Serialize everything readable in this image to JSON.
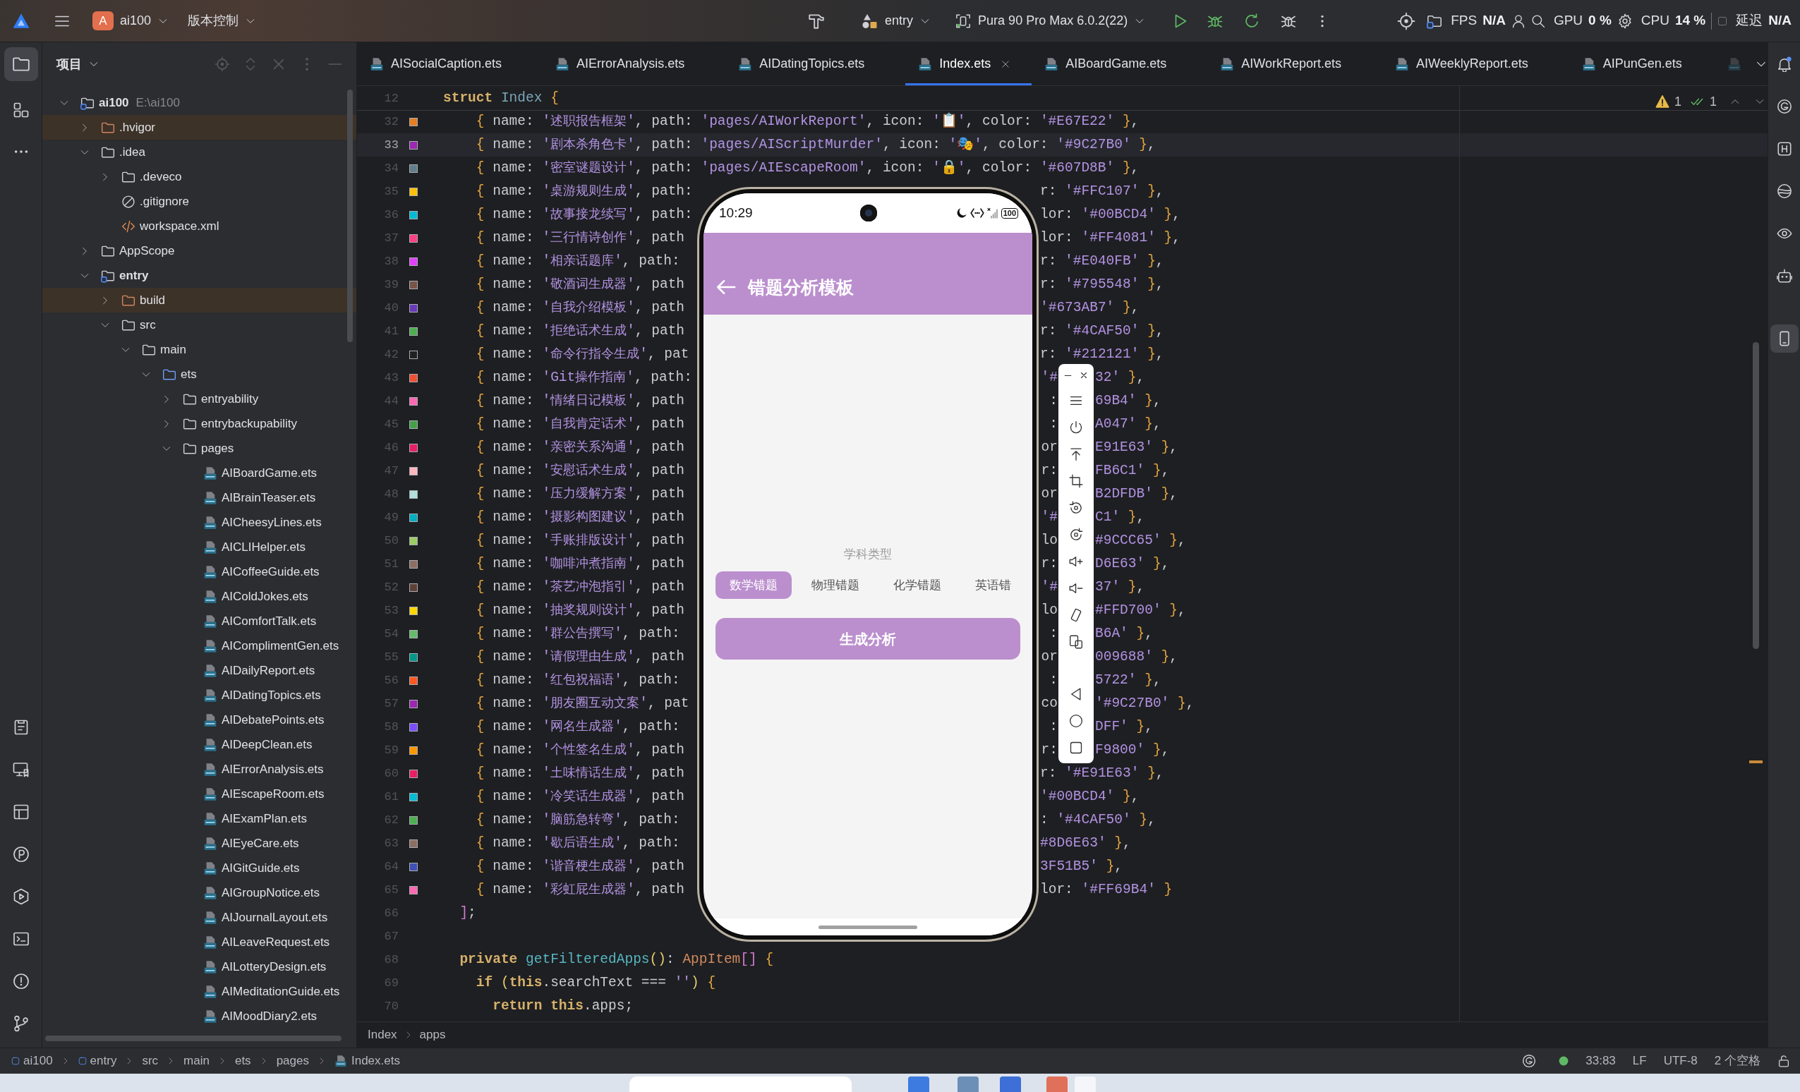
{
  "title_bar": {
    "project_badge": "A",
    "project": "ai100",
    "vcs_menu": "版本控制",
    "run_config": "entry",
    "device": "Pura 90 Pro Max 6.0.2(22)",
    "perf": [
      {
        "label": "FPS",
        "value": "N/A"
      },
      {
        "label": "GPU",
        "value": "0 %"
      },
      {
        "label": "CPU",
        "value": "14 %"
      },
      {
        "label": "延迟",
        "value": "N/A"
      }
    ]
  },
  "project_panel": {
    "title": "项目",
    "tree": [
      {
        "label": "ai100",
        "kind": "module",
        "location": "E:\\ai100",
        "expanded": true,
        "children": [
          {
            "label": ".hvigor",
            "kind": "excluded",
            "expanded": false
          },
          {
            "label": ".idea",
            "kind": "folder",
            "expanded": true,
            "children": [
              {
                "label": ".deveco",
                "kind": "folder",
                "expanded": false
              },
              {
                "label": ".gitignore",
                "kind": "ignore"
              },
              {
                "label": "workspace.xml",
                "kind": "xml"
              }
            ]
          },
          {
            "label": "AppScope",
            "kind": "folder",
            "expanded": false
          },
          {
            "label": "entry",
            "kind": "module",
            "expanded": true,
            "children": [
              {
                "label": "build",
                "kind": "excluded",
                "expanded": false
              },
              {
                "label": "src",
                "kind": "folder",
                "expanded": true,
                "children": [
                  {
                    "label": "main",
                    "kind": "folder",
                    "expanded": true,
                    "children": [
                      {
                        "label": "ets",
                        "kind": "source",
                        "expanded": true,
                        "children": [
                          {
                            "label": "entryability",
                            "kind": "folder",
                            "expanded": false
                          },
                          {
                            "label": "entrybackupability",
                            "kind": "folder",
                            "expanded": false
                          },
                          {
                            "label": "pages",
                            "kind": "folder",
                            "expanded": true,
                            "children": [
                              {
                                "label": "AIBoardGame.ets",
                                "kind": "ets"
                              },
                              {
                                "label": "AIBrainTeaser.ets",
                                "kind": "ets"
                              },
                              {
                                "label": "AICheesyLines.ets",
                                "kind": "ets"
                              },
                              {
                                "label": "AICLIHelper.ets",
                                "kind": "ets"
                              },
                              {
                                "label": "AICoffeeGuide.ets",
                                "kind": "ets"
                              },
                              {
                                "label": "AIColdJokes.ets",
                                "kind": "ets"
                              },
                              {
                                "label": "AIComfortTalk.ets",
                                "kind": "ets"
                              },
                              {
                                "label": "AIComplimentGen.ets",
                                "kind": "ets"
                              },
                              {
                                "label": "AIDailyReport.ets",
                                "kind": "ets"
                              },
                              {
                                "label": "AIDatingTopics.ets",
                                "kind": "ets"
                              },
                              {
                                "label": "AIDebatePoints.ets",
                                "kind": "ets"
                              },
                              {
                                "label": "AIDeepClean.ets",
                                "kind": "ets"
                              },
                              {
                                "label": "AIErrorAnalysis.ets",
                                "kind": "ets"
                              },
                              {
                                "label": "AIEscapeRoom.ets",
                                "kind": "ets"
                              },
                              {
                                "label": "AIExamPlan.ets",
                                "kind": "ets"
                              },
                              {
                                "label": "AIEyeCare.ets",
                                "kind": "ets"
                              },
                              {
                                "label": "AIGitGuide.ets",
                                "kind": "ets"
                              },
                              {
                                "label": "AIGroupNotice.ets",
                                "kind": "ets"
                              },
                              {
                                "label": "AIJournalLayout.ets",
                                "kind": "ets"
                              },
                              {
                                "label": "AILeaveRequest.ets",
                                "kind": "ets"
                              },
                              {
                                "label": "AILotteryDesign.ets",
                                "kind": "ets"
                              },
                              {
                                "label": "AIMeditationGuide.ets",
                                "kind": "ets"
                              },
                              {
                                "label": "AIMoodDiary2.ets",
                                "kind": "ets"
                              }
                            ]
                          }
                        ]
                      }
                    ]
                  }
                ]
              }
            ]
          }
        ]
      }
    ]
  },
  "editor_tabs": [
    {
      "label": "AISocialCaption.ets",
      "selected": false
    },
    {
      "label": "AIErrorAnalysis.ets",
      "selected": false
    },
    {
      "label": "AIDatingTopics.ets",
      "selected": false
    },
    {
      "label": "Index.ets",
      "selected": true
    },
    {
      "label": "AIBoardGame.ets",
      "selected": false
    },
    {
      "label": "AIWorkReport.ets",
      "selected": false
    },
    {
      "label": "AIWeeklyReport.ets",
      "selected": false
    },
    {
      "label": "AIPunGen.ets",
      "selected": false
    }
  ],
  "editor": {
    "warning_count": "1",
    "check_count": "1",
    "lines": [
      {
        "number": "12",
        "kind": "sticky",
        "current": false,
        "tokens": [
          {
            "kind": "keyword",
            "text": "struct"
          },
          {
            "kind": "class",
            "text": " Index"
          },
          {
            "kind": "plain",
            "text": " {"
          }
        ]
      },
      {
        "number": "32",
        "kind": "code",
        "color": "#E67E22",
        "current": false,
        "tokens": [
          {
            "kind": "plain",
            "text": "    { name: '述职报告框架', path: 'pages/AIWorkReport', icon: '📋', color: '#E67E22' },"
          }
        ]
      },
      {
        "number": "33",
        "kind": "code",
        "color": "#9C27B0",
        "current": true,
        "tokens": [
          {
            "kind": "plain",
            "text": "    { name: '剧本杀角色卡', path: 'pages/AIScriptMurder', icon: '🎭', color: '#9C27B0' },"
          }
        ]
      },
      {
        "number": "34",
        "kind": "code",
        "color": "#607D8B",
        "current": false,
        "tokens": [
          {
            "kind": "plain",
            "text": "    { name: '密室谜题设计', path: 'pages/AIEscapeRoom', icon: '🔒', color: '#607D8B' },"
          }
        ]
      },
      {
        "number": "35",
        "kind": "code",
        "color": "#FFC107",
        "current": false,
        "tokens": [
          {
            "kind": "plain",
            "text": "    { name: '桌游规则生成', path:"
          }
        ],
        "after_phone": [
          {
            "kind": "plain",
            "text": "r: '#FFC107' },"
          }
        ]
      },
      {
        "number": "36",
        "kind": "code",
        "color": "#00BCD4",
        "current": false,
        "tokens": [
          {
            "kind": "plain",
            "text": "    { name: '故事接龙续写', path:"
          }
        ],
        "after_phone": [
          {
            "kind": "plain",
            "text": "lor: '#00BCD4' },"
          }
        ]
      },
      {
        "number": "37",
        "kind": "code",
        "color": "#FF4081",
        "current": false,
        "tokens": [
          {
            "kind": "plain",
            "text": "    { name: '三行情诗创作', path"
          }
        ],
        "after_phone": [
          {
            "kind": "plain",
            "text": "lor: '#FF4081' },"
          }
        ]
      },
      {
        "number": "38",
        "kind": "code",
        "color": "#E040FB",
        "current": false,
        "tokens": [
          {
            "kind": "plain",
            "text": "    { name: '相亲话题库', path:"
          }
        ],
        "after_phone": [
          {
            "kind": "plain",
            "text": "r: '#E040FB' },"
          }
        ]
      },
      {
        "number": "39",
        "kind": "code",
        "color": "#795548",
        "current": false,
        "tokens": [
          {
            "kind": "plain",
            "text": "    { name: '敬酒词生成器', path"
          }
        ],
        "after_phone": [
          {
            "kind": "plain",
            "text": "r: '#795548' },"
          }
        ]
      },
      {
        "number": "40",
        "kind": "code",
        "color": "#673AB7",
        "current": false,
        "tokens": [
          {
            "kind": "plain",
            "text": "    { name: '自我介绍模板', path"
          }
        ],
        "after_phone": [
          {
            "kind": "plain",
            "text": "'#673AB7' },"
          }
        ]
      },
      {
        "number": "41",
        "kind": "code",
        "color": "#4CAF50",
        "current": false,
        "tokens": [
          {
            "kind": "plain",
            "text": "    { name: '拒绝话术生成', path"
          }
        ],
        "after_phone": [
          {
            "kind": "plain",
            "text": "r: '#4CAF50' },"
          }
        ]
      },
      {
        "number": "42",
        "kind": "code",
        "color": "#212121",
        "current": false,
        "tokens": [
          {
            "kind": "plain",
            "text": "    { name: '命令行指令生成', pat"
          }
        ],
        "after_phone": [
          {
            "kind": "plain",
            "text": "r: '#212121' },"
          }
        ]
      },
      {
        "number": "43",
        "kind": "code",
        "color": "#F05032",
        "current": false,
        "tokens": [
          {
            "kind": "plain",
            "text": "    { name: 'Git操作指南', path:"
          }
        ],
        "after_phone": [
          {
            "kind": "plain",
            "text": "'#"
          }
        ],
        "after_toolbar": [
          {
            "kind": "string",
            "text": "32'"
          },
          {
            "kind": "plain",
            "text": " },"
          }
        ]
      },
      {
        "number": "44",
        "kind": "code",
        "color": "#FF69B4",
        "current": false,
        "tokens": [
          {
            "kind": "plain",
            "text": "    { name: '情绪日记模板', path"
          }
        ],
        "after_phone": [
          {
            "kind": "plain",
            "text": ":"
          }
        ],
        "after_toolbar": [
          {
            "kind": "string",
            "text": "69B4'"
          },
          {
            "kind": "plain",
            "text": " },"
          }
        ]
      },
      {
        "number": "45",
        "kind": "code",
        "color": "#43A047",
        "current": false,
        "tokens": [
          {
            "kind": "plain",
            "text": "    { name: '自我肯定话术', path"
          }
        ],
        "after_phone": [
          {
            "kind": "plain",
            "text": ":"
          }
        ],
        "after_toolbar": [
          {
            "kind": "string",
            "text": "A047'"
          },
          {
            "kind": "plain",
            "text": " },"
          }
        ]
      },
      {
        "number": "46",
        "kind": "code",
        "color": "#E91E63",
        "current": false,
        "tokens": [
          {
            "kind": "plain",
            "text": "    { name: '亲密关系沟通', path"
          }
        ],
        "after_phone": [
          {
            "kind": "plain",
            "text": "or"
          }
        ],
        "after_toolbar": [
          {
            "kind": "string",
            "text": "E91E63'"
          },
          {
            "kind": "plain",
            "text": " },"
          }
        ]
      },
      {
        "number": "47",
        "kind": "code",
        "color": "#FFB6C1",
        "current": false,
        "tokens": [
          {
            "kind": "plain",
            "text": "    { name: '安慰话术生成', path"
          }
        ],
        "after_phone": [
          {
            "kind": "plain",
            "text": "r:"
          }
        ],
        "after_toolbar": [
          {
            "kind": "string",
            "text": "FB6C1'"
          },
          {
            "kind": "plain",
            "text": " },"
          }
        ]
      },
      {
        "number": "48",
        "kind": "code",
        "color": "#B2DFDB",
        "current": false,
        "tokens": [
          {
            "kind": "plain",
            "text": "    { name: '压力缓解方案', path"
          }
        ],
        "after_phone": [
          {
            "kind": "plain",
            "text": "or"
          }
        ],
        "after_toolbar": [
          {
            "kind": "string",
            "text": "B2DFDB'"
          },
          {
            "kind": "plain",
            "text": " },"
          }
        ]
      },
      {
        "number": "49",
        "kind": "code",
        "color": "#00ACC1",
        "current": false,
        "tokens": [
          {
            "kind": "plain",
            "text": "    { name: '摄影构图建议', path"
          }
        ],
        "after_phone": [
          {
            "kind": "plain",
            "text": "'#"
          }
        ],
        "after_toolbar": [
          {
            "kind": "string",
            "text": "C1'"
          },
          {
            "kind": "plain",
            "text": " },"
          }
        ]
      },
      {
        "number": "50",
        "kind": "code",
        "color": "#9CCC65",
        "current": false,
        "tokens": [
          {
            "kind": "plain",
            "text": "    { name: '手账排版设计', path"
          }
        ],
        "after_phone": [
          {
            "kind": "plain",
            "text": "lo"
          }
        ],
        "after_toolbar": [
          {
            "kind": "string",
            "text": "#9CCC65'"
          },
          {
            "kind": "plain",
            "text": " },"
          }
        ]
      },
      {
        "number": "51",
        "kind": "code",
        "color": "#8D6E63",
        "current": false,
        "tokens": [
          {
            "kind": "plain",
            "text": "    { name: '咖啡冲煮指南', path"
          }
        ],
        "after_phone": [
          {
            "kind": "plain",
            "text": "r:"
          }
        ],
        "after_toolbar": [
          {
            "kind": "string",
            "text": "D6E63'"
          },
          {
            "kind": "plain",
            "text": " },"
          }
        ]
      },
      {
        "number": "52",
        "kind": "code",
        "color": "#5D4037",
        "current": false,
        "tokens": [
          {
            "kind": "plain",
            "text": "    { name: '茶艺冲泡指引', path"
          }
        ],
        "after_phone": [
          {
            "kind": "plain",
            "text": "'#"
          }
        ],
        "after_toolbar": [
          {
            "kind": "string",
            "text": "37'"
          },
          {
            "kind": "plain",
            "text": " },"
          }
        ]
      },
      {
        "number": "53",
        "kind": "code",
        "color": "#FFD700",
        "current": false,
        "tokens": [
          {
            "kind": "plain",
            "text": "    { name: '抽奖规则设计', path"
          }
        ],
        "after_phone": [
          {
            "kind": "plain",
            "text": "lo"
          }
        ],
        "after_toolbar": [
          {
            "kind": "string",
            "text": "#FFD700'"
          },
          {
            "kind": "plain",
            "text": " },"
          }
        ]
      },
      {
        "number": "54",
        "kind": "code",
        "color": "#66BB6A",
        "current": false,
        "tokens": [
          {
            "kind": "plain",
            "text": "    { name: '群公告撰写', path:"
          }
        ],
        "after_phone": [
          {
            "kind": "plain",
            "text": ":"
          }
        ],
        "after_toolbar": [
          {
            "kind": "string",
            "text": "B6A'"
          },
          {
            "kind": "plain",
            "text": " },"
          }
        ]
      },
      {
        "number": "55",
        "kind": "code",
        "color": "#009688",
        "current": false,
        "tokens": [
          {
            "kind": "plain",
            "text": "    { name: '请假理由生成', path"
          }
        ],
        "after_phone": [
          {
            "kind": "plain",
            "text": "or"
          }
        ],
        "after_toolbar": [
          {
            "kind": "string",
            "text": "009688'"
          },
          {
            "kind": "plain",
            "text": " },"
          }
        ]
      },
      {
        "number": "56",
        "kind": "code",
        "color": "#FF5722",
        "current": false,
        "tokens": [
          {
            "kind": "plain",
            "text": "    { name: '红包祝福语', path:"
          }
        ],
        "after_phone": [
          {
            "kind": "plain",
            "text": ":"
          }
        ],
        "after_toolbar": [
          {
            "kind": "string",
            "text": "5722'"
          },
          {
            "kind": "plain",
            "text": " },"
          }
        ]
      },
      {
        "number": "57",
        "kind": "code",
        "color": "#9C27B0",
        "current": false,
        "tokens": [
          {
            "kind": "plain",
            "text": "    { name: '朋友圈互动文案', pat"
          }
        ],
        "after_phone": [
          {
            "kind": "plain",
            "text": "co"
          }
        ],
        "after_toolbar": [
          {
            "kind": "plain",
            "text": "'#9C27B0' },"
          }
        ]
      },
      {
        "number": "58",
        "kind": "code",
        "color": "#7C4DFF",
        "current": false,
        "tokens": [
          {
            "kind": "plain",
            "text": "    { name: '网名生成器', path:"
          }
        ],
        "after_phone": [
          {
            "kind": "plain",
            "text": ":"
          }
        ],
        "after_toolbar": [
          {
            "kind": "string",
            "text": "DFF'"
          },
          {
            "kind": "plain",
            "text": " },"
          }
        ]
      },
      {
        "number": "59",
        "kind": "code",
        "color": "#FF9800",
        "current": false,
        "tokens": [
          {
            "kind": "plain",
            "text": "    { name: '个性签名生成', path"
          }
        ],
        "after_phone": [
          {
            "kind": "plain",
            "text": "r:"
          }
        ],
        "after_toolbar": [
          {
            "kind": "string",
            "text": "F9800'"
          },
          {
            "kind": "plain",
            "text": " },"
          }
        ]
      },
      {
        "number": "60",
        "kind": "code",
        "color": "#E91E63",
        "current": false,
        "tokens": [
          {
            "kind": "plain",
            "text": "    { name: '土味情话生成', path"
          }
        ],
        "after_phone": [
          {
            "kind": "plain",
            "text": "r: '#E91E63' },"
          }
        ]
      },
      {
        "number": "61",
        "kind": "code",
        "color": "#00BCD4",
        "current": false,
        "tokens": [
          {
            "kind": "plain",
            "text": "    { name: '冷笑话生成器', path"
          }
        ],
        "after_phone": [
          {
            "kind": "plain",
            "text": "'#00BCD4' },"
          }
        ]
      },
      {
        "number": "62",
        "kind": "code",
        "color": "#4CAF50",
        "current": false,
        "tokens": [
          {
            "kind": "plain",
            "text": "    { name: '脑筋急转弯', path:"
          }
        ],
        "after_phone": [
          {
            "kind": "plain",
            "text": ": '#4CAF50' },"
          }
        ]
      },
      {
        "number": "63",
        "kind": "code",
        "color": "#8D6E63",
        "current": false,
        "tokens": [
          {
            "kind": "plain",
            "text": "    { name: '歇后语生成', path:"
          }
        ],
        "after_phone": [
          {
            "kind": "string",
            "text": "#8D6E63'"
          },
          {
            "kind": "plain",
            "text": " },"
          }
        ]
      },
      {
        "number": "64",
        "kind": "code",
        "color": "#3F51B5",
        "current": false,
        "tokens": [
          {
            "kind": "plain",
            "text": "    { name: '谐音梗生成器', path"
          }
        ],
        "after_phone": [
          {
            "kind": "string",
            "text": "3F51B5'"
          },
          {
            "kind": "plain",
            "text": " },"
          }
        ]
      },
      {
        "number": "65",
        "kind": "code",
        "color": "#FF69B4",
        "current": false,
        "tokens": [
          {
            "kind": "plain",
            "text": "    { name: '彩虹屁生成器', path"
          }
        ],
        "after_phone": [
          {
            "kind": "plain",
            "text": "lor: '#FF69B4' }"
          }
        ]
      },
      {
        "number": "66",
        "kind": "code",
        "current": false,
        "tokens": [
          {
            "kind": "plain",
            "text": "  ];"
          }
        ]
      },
      {
        "number": "67",
        "kind": "code",
        "current": false
      },
      {
        "number": "68",
        "kind": "code",
        "current": false,
        "tokens": [
          {
            "kind": "keyword",
            "text": "  private"
          },
          {
            "kind": "function",
            "text": " getFilteredApps"
          },
          {
            "kind": "plain",
            "text": "(): "
          },
          {
            "kind": "type",
            "text": "AppItem"
          },
          {
            "kind": "plain",
            "text": "[] {"
          }
        ]
      },
      {
        "number": "69",
        "kind": "code",
        "current": false,
        "tokens": [
          {
            "kind": "keyword",
            "text": "    if"
          },
          {
            "kind": "plain",
            "text": " ("
          },
          {
            "kind": "keyword",
            "text": "this"
          },
          {
            "kind": "plain",
            "text": ".searchText === '') {"
          }
        ]
      },
      {
        "number": "70",
        "kind": "code",
        "current": false,
        "tokens": [
          {
            "kind": "keyword",
            "text": "      return this"
          },
          {
            "kind": "plain",
            "text": ".apps;"
          }
        ]
      }
    ],
    "breadcrumb": [
      "Index",
      "apps"
    ]
  },
  "emulator": {
    "status_time": "10:29",
    "battery": "100",
    "title": "错题分析模板",
    "field_label": "学科类型",
    "subjects": [
      {
        "label": "数学错题",
        "selected": true
      },
      {
        "label": "物理错题",
        "selected": false
      },
      {
        "label": "化学错题",
        "selected": false
      },
      {
        "label": "英语错",
        "selected": false
      }
    ],
    "action": "生成分析"
  },
  "status_bar": {
    "path": [
      {
        "label": "ai100",
        "kind": "module"
      },
      {
        "label": "entry",
        "kind": "module"
      },
      {
        "label": "src",
        "kind": "folder"
      },
      {
        "label": "main",
        "kind": "folder"
      },
      {
        "label": "ets",
        "kind": "folder"
      },
      {
        "label": "pages",
        "kind": "folder"
      },
      {
        "label": "Index.ets",
        "kind": "file"
      }
    ],
    "caret": "33:83",
    "line_separator": "LF",
    "encoding": "UTF-8",
    "indent": "2 个空格"
  }
}
